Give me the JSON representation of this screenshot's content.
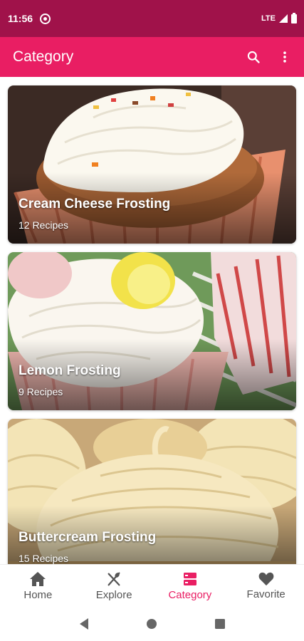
{
  "status_bar": {
    "time": "11:56",
    "network": "LTE"
  },
  "app_bar": {
    "title": "Category",
    "search_icon": "search-icon",
    "menu_icon": "more-vert-icon"
  },
  "categories": [
    {
      "title": "Cream Cheese Frosting",
      "count": "12 Recipes"
    },
    {
      "title": "Lemon Frosting",
      "count": "9 Recipes"
    },
    {
      "title": "Buttercream Frosting",
      "count": "15 Recipes"
    }
  ],
  "bottom_nav": {
    "items": [
      {
        "label": "Home",
        "icon": "home-icon"
      },
      {
        "label": "Explore",
        "icon": "utensils-icon"
      },
      {
        "label": "Category",
        "icon": "category-icon"
      },
      {
        "label": "Favorite",
        "icon": "heart-icon"
      }
    ],
    "active": "Category"
  },
  "colors": {
    "primary": "#e91e63",
    "status_bar": "#a0124a",
    "inactive": "#555555"
  }
}
